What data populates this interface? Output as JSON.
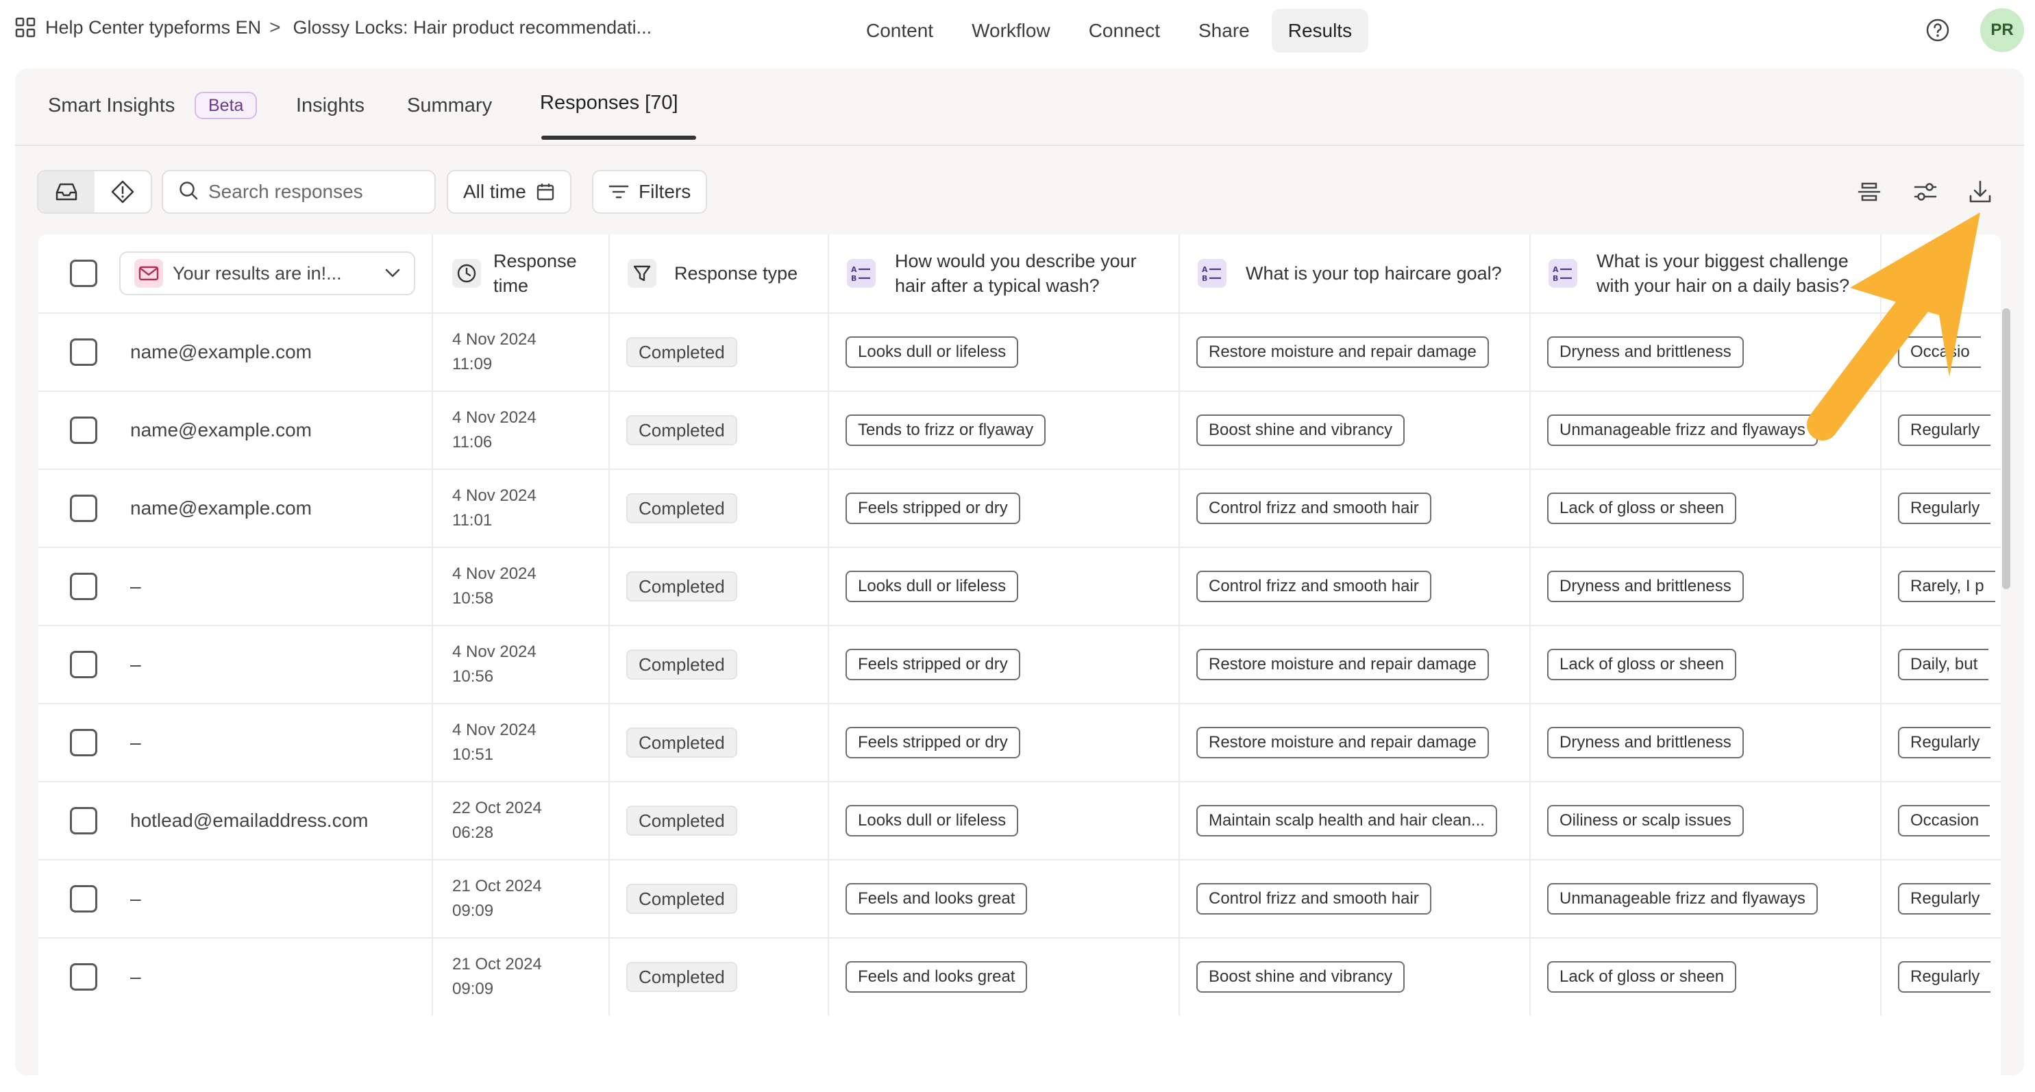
{
  "breadcrumb": {
    "workspace": "Help Center typeforms EN",
    "separator": ">",
    "form": "Glossy Locks: Hair product recommendati..."
  },
  "nav": {
    "items": [
      "Content",
      "Workflow",
      "Connect",
      "Share",
      "Results"
    ],
    "active": "Results"
  },
  "user": {
    "initials": "PR"
  },
  "tabs": {
    "smart_insights": "Smart Insights",
    "beta": "Beta",
    "insights": "Insights",
    "summary": "Summary",
    "responses": "Responses [70]"
  },
  "toolbar": {
    "search_placeholder": "Search responses",
    "time_filter": "All time",
    "filters": "Filters"
  },
  "table": {
    "select_label": "Your results are in!...",
    "headers": {
      "response_time": "Response time",
      "response_type": "Response type",
      "q1": "How would you describe your hair after a typical wash?",
      "q2": "What is your top haircare goal?",
      "q3": "What is your biggest challenge with your hair on a daily basis?"
    },
    "rows": [
      {
        "email": "name@example.com",
        "date": "4 Nov 2024",
        "time": "11:09",
        "status": "Completed",
        "q1": "Looks dull or lifeless",
        "q2": "Restore moisture and repair damage",
        "q3": "Dryness and brittleness",
        "q4": "Occasio"
      },
      {
        "email": "name@example.com",
        "date": "4 Nov 2024",
        "time": "11:06",
        "status": "Completed",
        "q1": "Tends to frizz or flyaway",
        "q2": "Boost shine and vibrancy",
        "q3": "Unmanageable frizz and flyaways",
        "q4": "Regularly"
      },
      {
        "email": "name@example.com",
        "date": "4 Nov 2024",
        "time": "11:01",
        "status": "Completed",
        "q1": "Feels stripped or dry",
        "q2": "Control frizz and smooth hair",
        "q3": "Lack of gloss or sheen",
        "q4": "Regularly"
      },
      {
        "email": "–",
        "date": "4 Nov 2024",
        "time": "10:58",
        "status": "Completed",
        "q1": "Looks dull or lifeless",
        "q2": "Control frizz and smooth hair",
        "q3": "Dryness and brittleness",
        "q4": "Rarely, I p"
      },
      {
        "email": "–",
        "date": "4 Nov 2024",
        "time": "10:56",
        "status": "Completed",
        "q1": "Feels stripped or dry",
        "q2": "Restore moisture and repair damage",
        "q3": "Lack of gloss or sheen",
        "q4": "Daily, but"
      },
      {
        "email": "–",
        "date": "4 Nov 2024",
        "time": "10:51",
        "status": "Completed",
        "q1": "Feels stripped or dry",
        "q2": "Restore moisture and repair damage",
        "q3": "Dryness and brittleness",
        "q4": "Regularly"
      },
      {
        "email": "hotlead@emailaddress.com",
        "date": "22 Oct 2024",
        "time": "06:28",
        "status": "Completed",
        "q1": "Looks dull or lifeless",
        "q2": "Maintain scalp health and hair clean...",
        "q3": "Oiliness or scalp issues",
        "q4": "Occasion"
      },
      {
        "email": "–",
        "date": "21 Oct 2024",
        "time": "09:09",
        "status": "Completed",
        "q1": "Feels and looks great",
        "q2": "Control frizz and smooth hair",
        "q3": "Unmanageable frizz and flyaways",
        "q4": "Regularly"
      },
      {
        "email": "–",
        "date": "21 Oct 2024",
        "time": "09:09",
        "status": "Completed",
        "q1": "Feels and looks great",
        "q2": "Boost shine and vibrancy",
        "q3": "Lack of gloss or sheen",
        "q4": "Regularly"
      }
    ]
  },
  "colors": {
    "arrow": "#f9b233",
    "beta_border": "#d9b9ea",
    "avatar_bg": "#c9ebc6",
    "question_icon_bg": "#e7e1f7"
  }
}
